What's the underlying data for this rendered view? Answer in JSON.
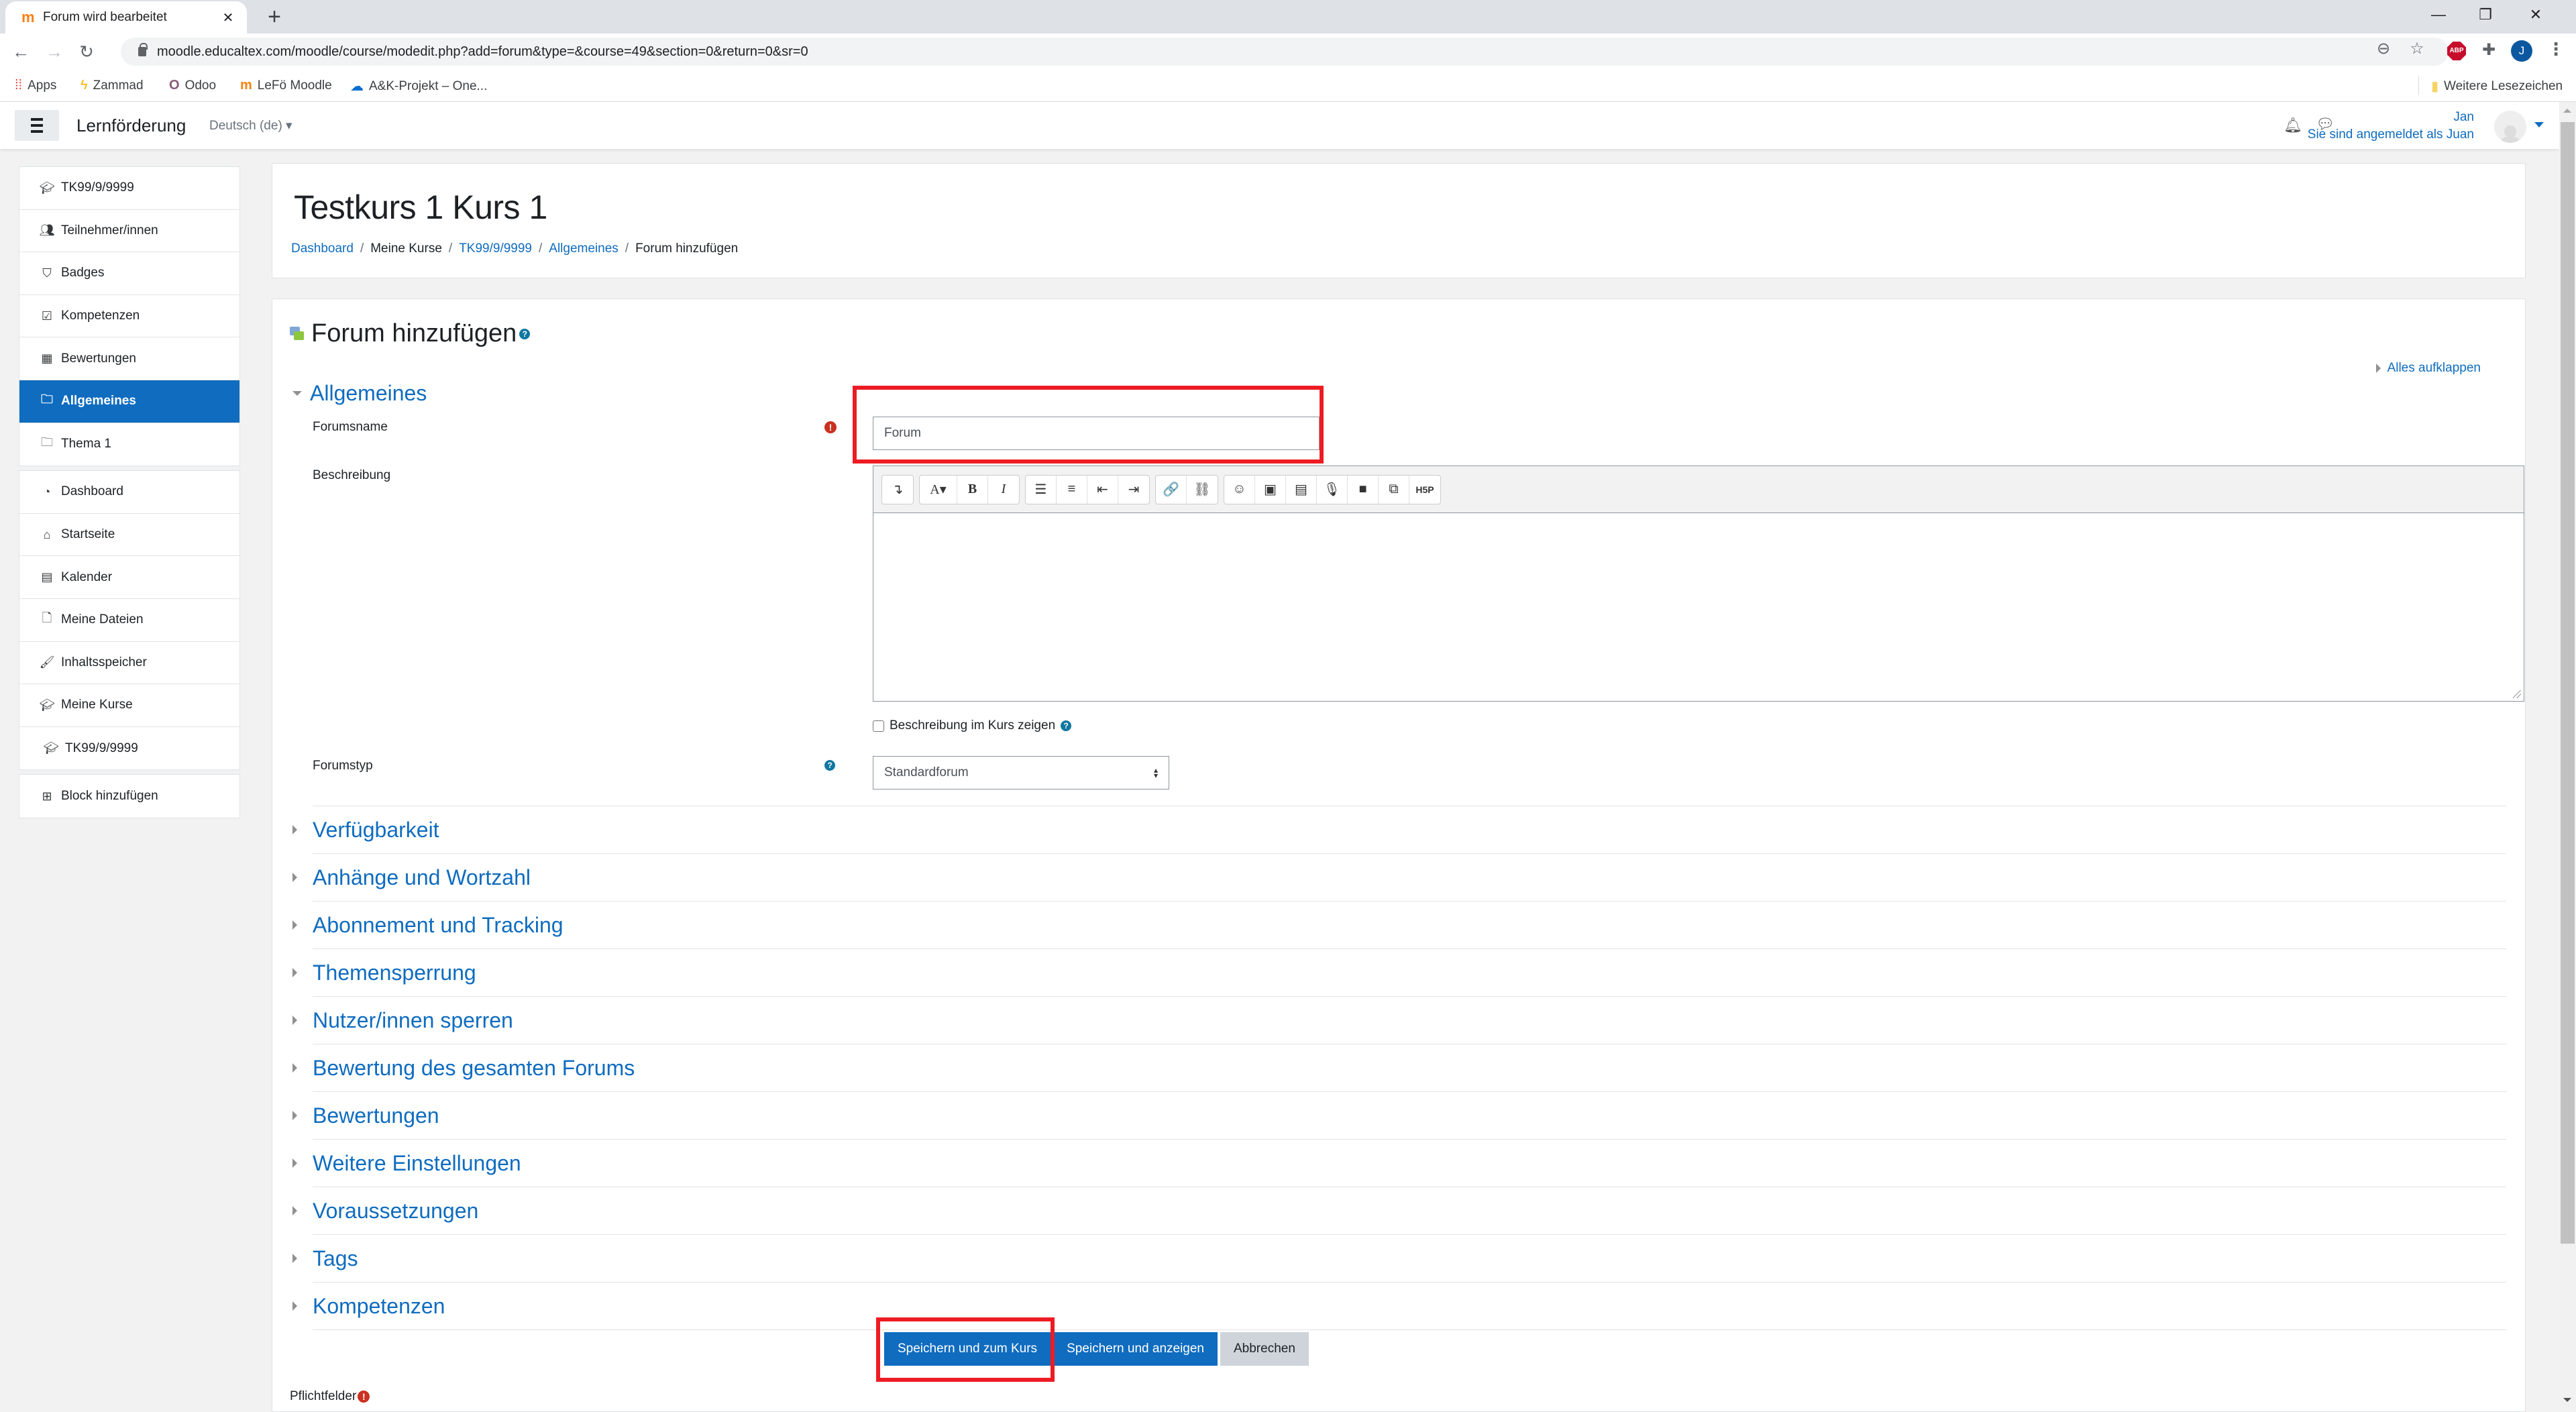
{
  "browser": {
    "tab_title": "Forum wird bearbeitet",
    "url": "moodle.educaltex.com/moodle/course/modedit.php?add=forum&type=&course=49&section=0&return=0&sr=0",
    "profile_initial": "J",
    "extension_label": "ABP",
    "bookmarks": [
      {
        "label": "Apps",
        "icon": "apps-grid-icon"
      },
      {
        "label": "Zammad",
        "icon": "zammad-icon"
      },
      {
        "label": "Odoo",
        "icon": "odoo-icon"
      },
      {
        "label": "LeFö Moodle",
        "icon": "moodle-icon"
      },
      {
        "label": "A&K-Projekt – One...",
        "icon": "onedrive-icon"
      }
    ],
    "other_bookmarks": "Weitere Lesezeichen"
  },
  "navbar": {
    "site_name": "Lernförderung",
    "language": "Deutsch (de)",
    "user_name": "Jan",
    "logged_in_as": "Sie sind angemeldet als Juan"
  },
  "sidebar": {
    "course_items": [
      {
        "label": "TK99/9/9999",
        "icon": "graduation-cap-icon"
      },
      {
        "label": "Teilnehmer/innen",
        "icon": "users-icon"
      },
      {
        "label": "Badges",
        "icon": "shield-icon"
      },
      {
        "label": "Kompetenzen",
        "icon": "check-square-icon"
      },
      {
        "label": "Bewertungen",
        "icon": "table-icon"
      },
      {
        "label": "Allgemeines",
        "icon": "folder-icon",
        "active": true
      },
      {
        "label": "Thema 1",
        "icon": "folder-icon"
      }
    ],
    "site_items": [
      {
        "label": "Dashboard",
        "icon": "dashboard-icon"
      },
      {
        "label": "Startseite",
        "icon": "home-icon"
      },
      {
        "label": "Kalender",
        "icon": "calendar-icon"
      },
      {
        "label": "Meine Dateien",
        "icon": "file-icon"
      },
      {
        "label": "Inhaltsspeicher",
        "icon": "paintbrush-icon"
      },
      {
        "label": "Meine Kurse",
        "icon": "graduation-cap-icon"
      },
      {
        "label": "TK99/9/9999",
        "icon": "graduation-cap-icon"
      }
    ],
    "add_block": "Block hinzufügen"
  },
  "header": {
    "title": "Testkurs 1 Kurs 1",
    "breadcrumb": [
      {
        "label": "Dashboard",
        "link": true
      },
      {
        "label": "Meine Kurse",
        "link": false
      },
      {
        "label": "TK99/9/9999",
        "link": true
      },
      {
        "label": "Allgemeines",
        "link": true
      },
      {
        "label": "Forum hinzufügen",
        "link": false
      }
    ]
  },
  "form": {
    "title": "Forum hinzufügen",
    "expand_all": "Alles aufklappen",
    "general_section": "Allgemeines",
    "forum_name_label": "Forumsname",
    "forum_name_value": "Forum",
    "description_label": "Beschreibung",
    "show_description_label": "Beschreibung im Kurs zeigen",
    "show_description_checked": false,
    "forum_type_label": "Forumstyp",
    "forum_type_value": "Standardforum",
    "collapsed_sections": [
      "Verfügbarkeit",
      "Anhänge und Wortzahl",
      "Abonnement und Tracking",
      "Themensperrung",
      "Nutzer/innen sperren",
      "Bewertung des gesamten Forums",
      "Bewertungen",
      "Weitere Einstellungen",
      "Voraussetzungen",
      "Tags",
      "Kompetenzen"
    ],
    "buttons": {
      "save_return": "Speichern und zum Kurs",
      "save_display": "Speichern und anzeigen",
      "cancel": "Abbrechen"
    },
    "required_note": "Pflichtfelder"
  },
  "editor_toolbar": {
    "groups": [
      [
        {
          "icon": "collapse-toolbar-icon",
          "glyph": "↴"
        }
      ],
      [
        {
          "icon": "font-style-icon",
          "glyph": "A▾"
        },
        {
          "icon": "bold-icon",
          "glyph": "B"
        },
        {
          "icon": "italic-icon",
          "glyph": "I"
        }
      ],
      [
        {
          "icon": "unordered-list-icon",
          "glyph": "☰"
        },
        {
          "icon": "ordered-list-icon",
          "glyph": "≡"
        },
        {
          "icon": "outdent-icon",
          "glyph": "⇤"
        },
        {
          "icon": "indent-icon",
          "glyph": "⇥"
        }
      ],
      [
        {
          "icon": "link-icon",
          "glyph": "🔗"
        },
        {
          "icon": "unlink-icon",
          "glyph": "⛓"
        }
      ],
      [
        {
          "icon": "emoji-icon",
          "glyph": "☺"
        },
        {
          "icon": "image-icon",
          "glyph": "▣"
        },
        {
          "icon": "media-icon",
          "glyph": "▤"
        },
        {
          "icon": "microphone-icon",
          "glyph": "🎙"
        },
        {
          "icon": "video-icon",
          "glyph": "■"
        },
        {
          "icon": "manage-files-icon",
          "glyph": "⧉"
        },
        {
          "icon": "h5p-icon",
          "glyph": "H5P"
        }
      ]
    ]
  },
  "colors": {
    "brand_blue": "#0f6cbf",
    "highlight_red": "#ed1c24",
    "required_red": "#ca3120",
    "help_teal": "#1177a1"
  }
}
